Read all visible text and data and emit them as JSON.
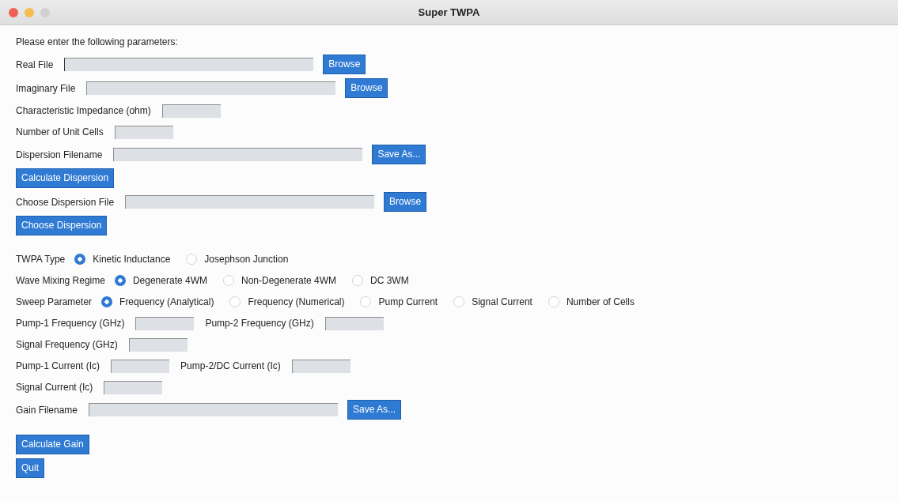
{
  "window": {
    "title": "Super TWPA"
  },
  "sections": [
    [
      {
        "kind": "text",
        "text": "Please enter the following parameters:"
      },
      {
        "kind": "fields",
        "items": [
          {
            "label": "Real File",
            "kind": "file",
            "focused": true
          }
        ],
        "button": "Browse"
      },
      {
        "kind": "fields",
        "items": [
          {
            "label": "Imaginary File",
            "kind": "file"
          }
        ],
        "button": "Browse"
      },
      {
        "kind": "fields",
        "items": [
          {
            "label": "Characteristic Impedance (ohm)",
            "kind": "value"
          }
        ]
      },
      {
        "kind": "fields",
        "items": [
          {
            "label": "Number of Unit Cells",
            "kind": "value"
          }
        ]
      },
      {
        "kind": "fields",
        "items": [
          {
            "label": "Dispersion Filename",
            "kind": "file"
          }
        ],
        "button": "Save As..."
      },
      {
        "kind": "button",
        "label": "Calculate Dispersion"
      },
      {
        "kind": "fields",
        "items": [
          {
            "label": "Choose Dispersion File",
            "kind": "file"
          }
        ],
        "button": "Browse"
      },
      {
        "kind": "button",
        "label": "Choose Dispersion"
      }
    ],
    [
      {
        "kind": "radios",
        "label": "TWPA Type",
        "options": [
          {
            "label": "Kinetic Inductance",
            "selected": true
          },
          {
            "label": "Josephson Junction",
            "selected": false
          }
        ]
      },
      {
        "kind": "radios",
        "label": "Wave Mixing Regime",
        "options": [
          {
            "label": "Degenerate 4WM",
            "selected": true
          },
          {
            "label": "Non-Degenerate 4WM",
            "selected": false
          },
          {
            "label": "DC 3WM",
            "selected": false
          }
        ]
      },
      {
        "kind": "radios",
        "label": "Sweep Parameter",
        "options": [
          {
            "label": "Frequency (Analytical)",
            "selected": true
          },
          {
            "label": "Frequency (Numerical)",
            "selected": false
          },
          {
            "label": "Pump Current",
            "selected": false
          },
          {
            "label": "Signal Current",
            "selected": false
          },
          {
            "label": "Number of Cells",
            "selected": false
          }
        ]
      },
      {
        "kind": "fields",
        "items": [
          {
            "label": "Pump-1 Frequency (GHz)",
            "kind": "value"
          },
          {
            "label": "Pump-2 Frequency (GHz)",
            "kind": "value"
          }
        ]
      },
      {
        "kind": "fields",
        "items": [
          {
            "label": "Signal Frequency (GHz)",
            "kind": "value"
          }
        ]
      },
      {
        "kind": "fields",
        "items": [
          {
            "label": "Pump-1 Current (Ic)",
            "kind": "value"
          },
          {
            "label": "Pump-2/DC Current (Ic)",
            "kind": "value"
          }
        ]
      },
      {
        "kind": "fields",
        "items": [
          {
            "label": "Signal Current (Ic)",
            "kind": "value"
          }
        ]
      },
      {
        "kind": "fields",
        "items": [
          {
            "label": "Gain Filename",
            "kind": "file"
          }
        ],
        "button": "Save As..."
      }
    ],
    [
      {
        "kind": "button",
        "label": "Calculate Gain"
      },
      {
        "kind": "button",
        "label": "Quit"
      }
    ]
  ]
}
